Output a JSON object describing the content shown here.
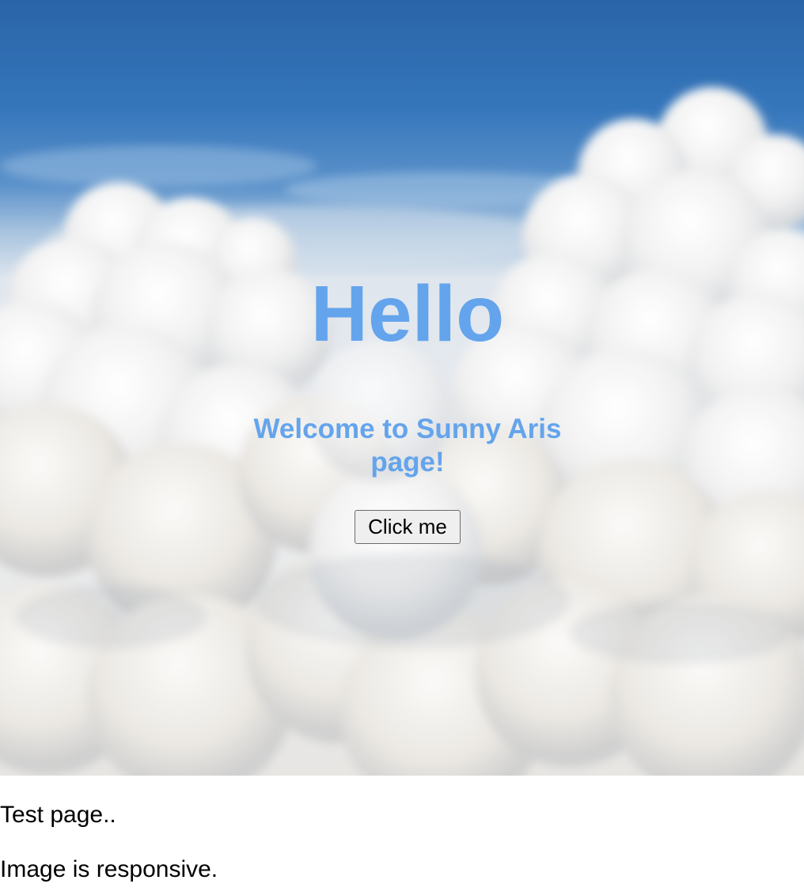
{
  "hero": {
    "title": "Hello",
    "subtitle": "Welcome to Sunny Aris page!",
    "button_label": "Click me",
    "image": "cloudy-sky-image",
    "title_color": "#64a4ec"
  },
  "content": {
    "paragraphs": [
      "Test page..",
      "Image is responsive."
    ]
  }
}
